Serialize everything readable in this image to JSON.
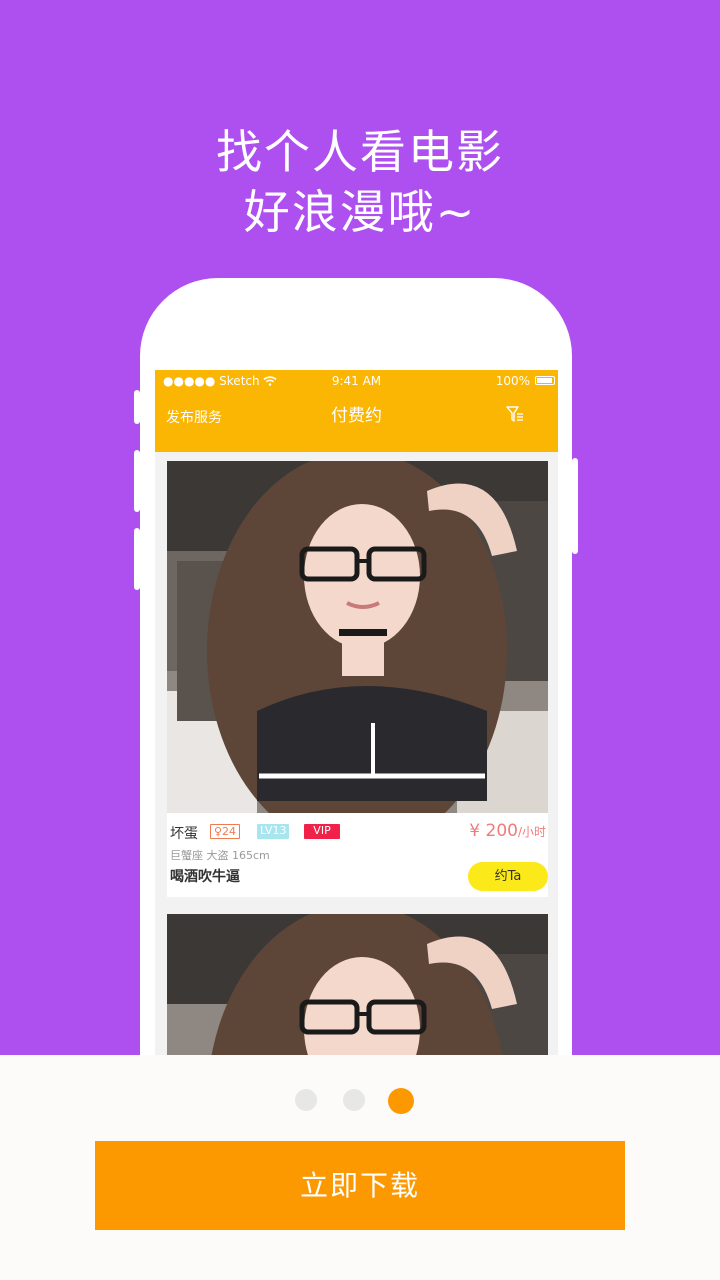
{
  "headline": {
    "line1": "找个人看电影",
    "line2": "好浪漫哦~"
  },
  "status_bar": {
    "carrier": "●●●●● Sketch",
    "time": "9:41 AM",
    "battery": "100%"
  },
  "nav": {
    "left_action": "发布服务",
    "title": "付费约",
    "filter_icon": "filter-icon"
  },
  "cards": [
    {
      "name": "坏蛋",
      "age_badge": "♀24",
      "level_badge": "LV13",
      "vip_badge": "VIP",
      "meta": "巨蟹座 大盗 165cm",
      "bio": "喝酒吹牛逼",
      "price": "¥ 200",
      "price_unit": "/小时",
      "action": "约Ta"
    }
  ],
  "pager": {
    "count": 3,
    "active_index": 2
  },
  "download_button": "立即下载",
  "colors": {
    "background": "#ae4ff0",
    "nav": "#fbb503",
    "accent": "#fd9900",
    "action_button": "#fbe91a",
    "vip": "#f0224a",
    "level": "#a8e6ef",
    "price": "#f07b7b"
  }
}
